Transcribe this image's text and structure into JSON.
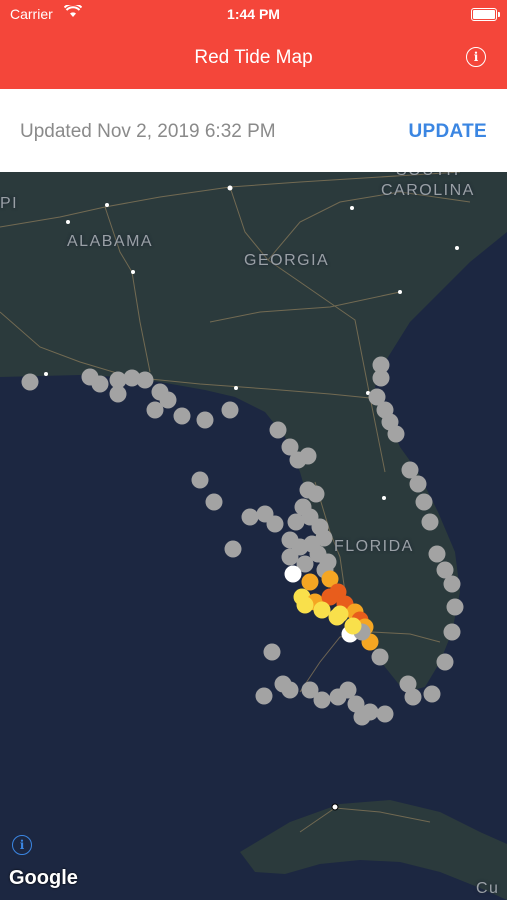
{
  "status_bar": {
    "carrier": "Carrier",
    "time": "1:44 PM"
  },
  "nav": {
    "title": "Red Tide Map",
    "info_icon": "info-circle-icon"
  },
  "update_bar": {
    "updated_text": "Updated Nov 2, 2019 6:32 PM",
    "update_label": "UPDATE"
  },
  "map": {
    "labels": {
      "pi": "PI",
      "alabama": "ALABAMA",
      "georgia": "GEORGIA",
      "south": "SOUTH",
      "carolina": "CAROLINA",
      "florida": "FLORIDA",
      "cu": "Cu"
    },
    "attribution": "Google",
    "marker_colors": {
      "none": "#a3a3a3",
      "very_low": "#ffffff",
      "low": "#f9e04b",
      "medium": "#f5a623",
      "high": "#e85d1c"
    }
  },
  "colors": {
    "header": "#f4463a",
    "accent": "#3b86e2",
    "water": "#1c2741",
    "land": "#2b3a3c"
  }
}
